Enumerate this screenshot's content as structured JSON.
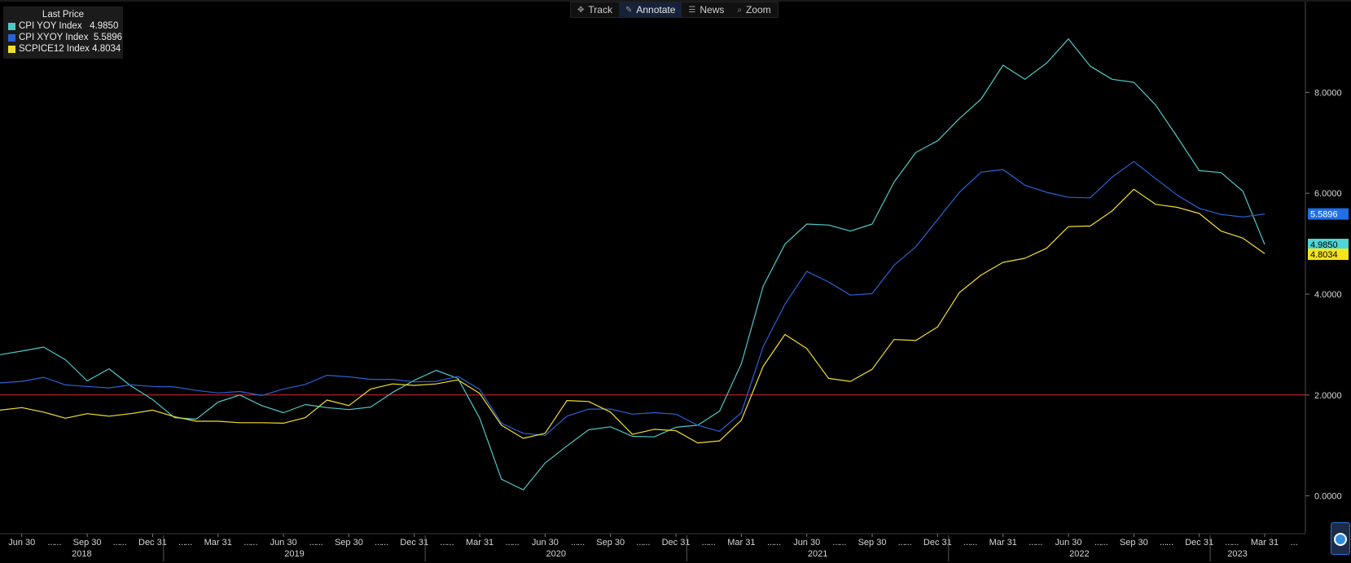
{
  "toolbar": {
    "items": [
      {
        "label": "Track",
        "icon": "crosshair-icon"
      },
      {
        "label": "Annotate",
        "icon": "pencil-icon"
      },
      {
        "label": "News",
        "icon": "news-icon"
      },
      {
        "label": "Zoom",
        "icon": "magnifier-icon"
      }
    ],
    "active_index": 1
  },
  "legend": {
    "title": "Last Price",
    "items": [
      {
        "name": "CPI YOY Index",
        "value": "4.9850",
        "color": "#4fc8c8"
      },
      {
        "name": "CPI XYOY Index",
        "value": "5.5896",
        "color": "#2a62d6"
      },
      {
        "name": "SCPICE12 Index",
        "value": "4.8034",
        "color": "#f2de2e"
      }
    ]
  },
  "chart_data": {
    "type": "line",
    "x_dates": [
      "2018-05",
      "2018-06",
      "2018-07",
      "2018-08",
      "2018-09",
      "2018-10",
      "2018-11",
      "2018-12",
      "2019-01",
      "2019-02",
      "2019-03",
      "2019-04",
      "2019-05",
      "2019-06",
      "2019-07",
      "2019-08",
      "2019-09",
      "2019-10",
      "2019-11",
      "2019-12",
      "2020-01",
      "2020-02",
      "2020-03",
      "2020-04",
      "2020-05",
      "2020-06",
      "2020-07",
      "2020-08",
      "2020-09",
      "2020-10",
      "2020-11",
      "2020-12",
      "2021-01",
      "2021-02",
      "2021-03",
      "2021-04",
      "2021-05",
      "2021-06",
      "2021-07",
      "2021-08",
      "2021-09",
      "2021-10",
      "2021-11",
      "2021-12",
      "2022-01",
      "2022-02",
      "2022-03",
      "2022-04",
      "2022-05",
      "2022-06",
      "2022-07",
      "2022-08",
      "2022-09",
      "2022-10",
      "2022-11",
      "2022-12",
      "2023-01",
      "2023-02",
      "2023-03"
    ],
    "series": [
      {
        "name": "CPI YOY Index",
        "color": "#4fc8c8",
        "values": [
          2.8,
          2.87,
          2.95,
          2.7,
          2.28,
          2.52,
          2.18,
          1.91,
          1.55,
          1.52,
          1.86,
          2.0,
          1.79,
          1.65,
          1.81,
          1.75,
          1.71,
          1.76,
          2.05,
          2.29,
          2.49,
          2.33,
          1.54,
          0.33,
          0.12,
          0.65,
          0.99,
          1.31,
          1.37,
          1.18,
          1.17,
          1.36,
          1.4,
          1.68,
          2.62,
          4.16,
          4.99,
          5.39,
          5.37,
          5.25,
          5.39,
          6.22,
          6.81,
          7.04,
          7.48,
          7.87,
          8.54,
          8.26,
          8.58,
          9.06,
          8.52,
          8.26,
          8.2,
          7.75,
          7.11,
          6.45,
          6.41,
          6.04,
          4.985
        ]
      },
      {
        "name": "CPI XYOY Index",
        "color": "#2a62d6",
        "values": [
          2.24,
          2.27,
          2.35,
          2.2,
          2.17,
          2.14,
          2.2,
          2.17,
          2.16,
          2.09,
          2.04,
          2.07,
          1.99,
          2.12,
          2.21,
          2.39,
          2.36,
          2.31,
          2.31,
          2.26,
          2.27,
          2.37,
          2.11,
          1.44,
          1.24,
          1.2,
          1.58,
          1.72,
          1.72,
          1.62,
          1.65,
          1.62,
          1.4,
          1.28,
          1.65,
          2.96,
          3.8,
          4.45,
          4.24,
          3.98,
          4.01,
          4.57,
          4.94,
          5.48,
          6.02,
          6.42,
          6.47,
          6.16,
          6.02,
          5.92,
          5.91,
          6.32,
          6.63,
          6.29,
          5.96,
          5.7,
          5.58,
          5.53,
          5.5896
        ]
      },
      {
        "name": "SCPICE12 Index",
        "color": "#f2de2e",
        "values": [
          1.7,
          1.75,
          1.66,
          1.54,
          1.63,
          1.58,
          1.63,
          1.7,
          1.57,
          1.48,
          1.48,
          1.45,
          1.45,
          1.44,
          1.55,
          1.9,
          1.79,
          2.12,
          2.22,
          2.19,
          2.22,
          2.3,
          2.03,
          1.4,
          1.14,
          1.24,
          1.89,
          1.87,
          1.66,
          1.22,
          1.32,
          1.29,
          1.05,
          1.09,
          1.5,
          2.57,
          3.2,
          2.92,
          2.33,
          2.27,
          2.51,
          3.1,
          3.08,
          3.35,
          4.03,
          4.38,
          4.63,
          4.71,
          4.91,
          5.34,
          5.35,
          5.65,
          6.08,
          5.78,
          5.72,
          5.6,
          5.25,
          5.11,
          4.8034
        ]
      }
    ],
    "y_ticks": [
      "0.0000",
      "2.0000",
      "4.0000",
      "6.0000",
      "8.0000"
    ],
    "ylim": [
      -0.75,
      9.8
    ],
    "reference_line": {
      "value": 2.0,
      "color": "#e0282d"
    },
    "x_tick_labels": [
      {
        "date": "2018-06",
        "label": "Jun 30"
      },
      {
        "date": "2018-09",
        "label": "Sep 30"
      },
      {
        "date": "2018-12",
        "label": "Dec 31"
      },
      {
        "date": "2019-03",
        "label": "Mar 31"
      },
      {
        "date": "2019-06",
        "label": "Jun 30"
      },
      {
        "date": "2019-09",
        "label": "Sep 30"
      },
      {
        "date": "2019-12",
        "label": "Dec 31"
      },
      {
        "date": "2020-03",
        "label": "Mar 31"
      },
      {
        "date": "2020-06",
        "label": "Jun 30"
      },
      {
        "date": "2020-09",
        "label": "Sep 30"
      },
      {
        "date": "2020-12",
        "label": "Dec 31"
      },
      {
        "date": "2021-03",
        "label": "Mar 31"
      },
      {
        "date": "2021-06",
        "label": "Jun 30"
      },
      {
        "date": "2021-09",
        "label": "Sep 30"
      },
      {
        "date": "2021-12",
        "label": "Dec 31"
      },
      {
        "date": "2022-03",
        "label": "Mar 31"
      },
      {
        "date": "2022-06",
        "label": "Jun 30"
      },
      {
        "date": "2022-09",
        "label": "Sep 30"
      },
      {
        "date": "2022-12",
        "label": "Dec 31"
      },
      {
        "date": "2023-03",
        "label": "Mar 31"
      }
    ],
    "year_labels": [
      "2018",
      "2019",
      "2020",
      "2021",
      "2022",
      "2023"
    ],
    "last_value_labels": [
      {
        "text": "5.5896",
        "value": 5.5896,
        "bg": "#1f6fe8",
        "fg": "#ffffff"
      },
      {
        "text": "4.9850",
        "value": 4.985,
        "bg": "#4fd6d6",
        "fg": "#000000"
      },
      {
        "text": "4.8034",
        "value": 4.8034,
        "bg": "#f5e31e",
        "fg": "#000000"
      }
    ]
  }
}
